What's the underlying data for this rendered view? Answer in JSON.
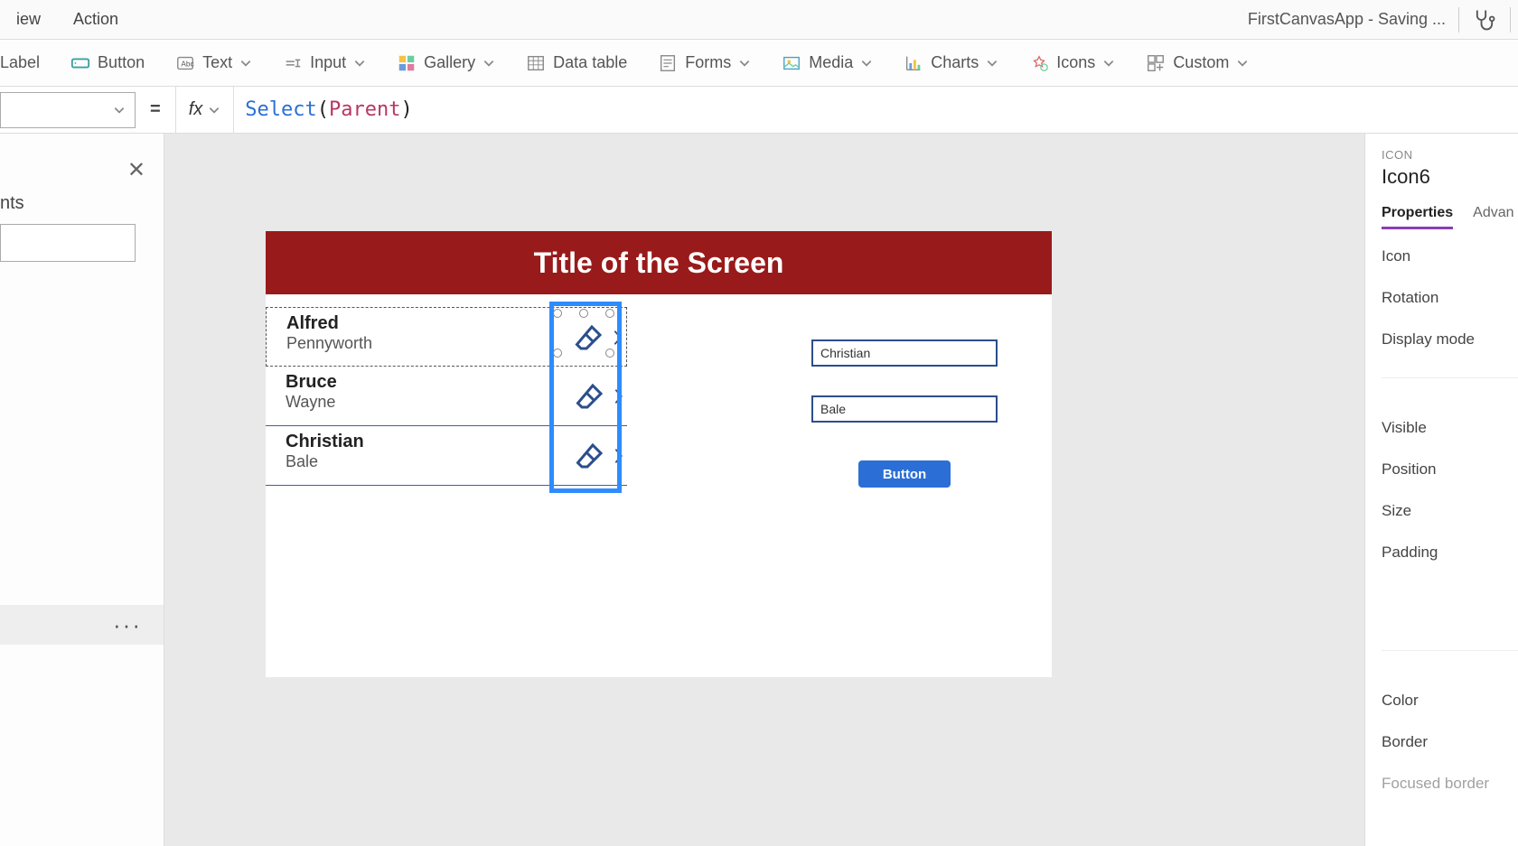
{
  "menu": {
    "view": "iew",
    "action": "Action"
  },
  "app_title": "FirstCanvasApp - Saving ...",
  "ribbon": {
    "label": "Label",
    "button": "Button",
    "text": "Text",
    "input": "Input",
    "gallery": "Gallery",
    "datatable": "Data table",
    "forms": "Forms",
    "media": "Media",
    "charts": "Charts",
    "icons": "Icons",
    "custom": "Custom"
  },
  "formula": {
    "fn": "Select",
    "arg": "Parent"
  },
  "left": {
    "nts": "nts"
  },
  "canvas": {
    "title": "Title of the Screen",
    "gallery": [
      {
        "title": "Alfred",
        "sub": "Pennyworth"
      },
      {
        "title": "Bruce",
        "sub": "Wayne"
      },
      {
        "title": "Christian",
        "sub": "Bale"
      }
    ],
    "input1": "Christian",
    "input2": "Bale",
    "button": "Button"
  },
  "right": {
    "type": "ICON",
    "name": "Icon6",
    "tab_properties": "Properties",
    "tab_advanced": "Advan",
    "props": {
      "icon": "Icon",
      "rotation": "Rotation",
      "display": "Display mode",
      "visible": "Visible",
      "position": "Position",
      "size": "Size",
      "padding": "Padding",
      "color": "Color",
      "border": "Border",
      "focused": "Focused border"
    }
  }
}
